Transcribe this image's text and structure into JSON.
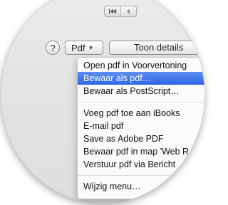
{
  "toolbar": {
    "help_label": "?",
    "pdf_button_label": "Pdf",
    "toon_details_label": "Toon details"
  },
  "icons": {
    "pager_first": "skip-to-start-icon",
    "pager_prev": "previous-icon",
    "pdf_dropdown": "dropdown-triangle-icon"
  },
  "colors": {
    "selection_top": "#5b8df2",
    "selection_bottom": "#2f67e4"
  },
  "menu": {
    "items": [
      "Open pdf in Voorvertoning",
      "Bewaar als pdf…",
      "Bewaar als PostScript…",
      "Voeg pdf toe aan iBooks",
      "E-mail pdf",
      "Save as Adobe PDF",
      "Bewaar pdf in map 'Web R",
      "Verstuur pdf via Bericht",
      "Wijzig menu…"
    ],
    "selected_index": 1
  }
}
